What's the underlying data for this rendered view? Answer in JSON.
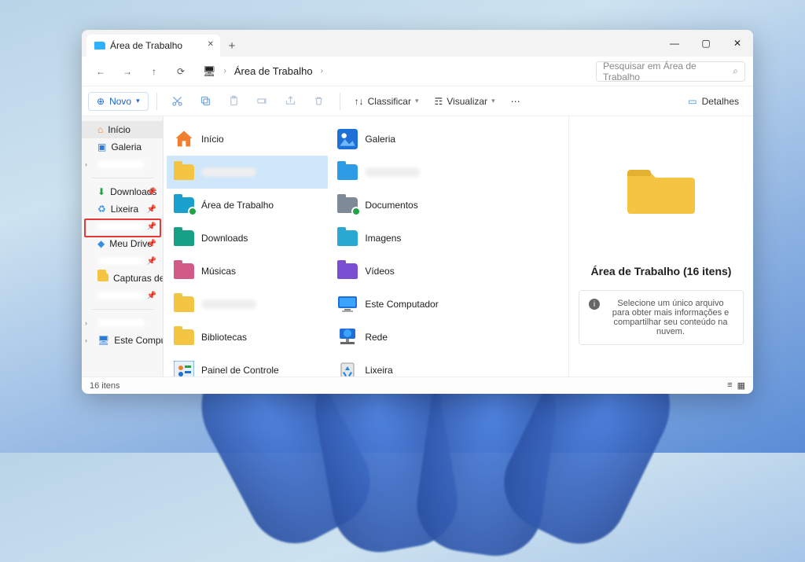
{
  "tab": {
    "title": "Área de Trabalho"
  },
  "breadcrumb": {
    "location": "Área de Trabalho"
  },
  "search": {
    "placeholder": "Pesquisar em Área de Trabalho"
  },
  "cmdbar": {
    "new": "Novo",
    "sort": "Classificar",
    "view": "Visualizar",
    "details": "Detalhes"
  },
  "nav": {
    "home": "Início",
    "gallery": "Galeria",
    "downloads": "Downloads",
    "recycle": "Lixeira",
    "mydrive": "Meu Drive",
    "captures": "Capturas de Tela",
    "thispc": "Este Computador"
  },
  "items": {
    "c0": [
      {
        "label": "Início",
        "kind": "home"
      },
      {
        "label": "",
        "kind": "folder-yellow",
        "selected": true,
        "blurred": true
      },
      {
        "label": "Área de Trabalho",
        "kind": "folder-cyan-sync"
      },
      {
        "label": "Downloads",
        "kind": "folder-green"
      },
      {
        "label": "Músicas",
        "kind": "folder-pink"
      },
      {
        "label": "",
        "kind": "folder-yellow",
        "blurred": true
      },
      {
        "label": "Bibliotecas",
        "kind": "folder-yellow"
      },
      {
        "label": "Painel de Controle",
        "kind": "control-panel"
      }
    ],
    "c1": [
      {
        "label": "Galeria",
        "kind": "gallery"
      },
      {
        "label": "",
        "kind": "folder-blue",
        "blurred": true
      },
      {
        "label": "Documentos",
        "kind": "folder-gray-sync"
      },
      {
        "label": "Imagens",
        "kind": "folder-cyan"
      },
      {
        "label": "Vídeos",
        "kind": "folder-purple"
      },
      {
        "label": "Este Computador",
        "kind": "pc"
      },
      {
        "label": "Rede",
        "kind": "network"
      },
      {
        "label": "Lixeira",
        "kind": "recycle"
      }
    ]
  },
  "preview": {
    "title": "Área de Trabalho (16 itens)",
    "info": "Selecione um único arquivo para obter mais informações e compartilhar seu conteúdo na nuvem."
  },
  "status": {
    "count": "16 itens"
  }
}
